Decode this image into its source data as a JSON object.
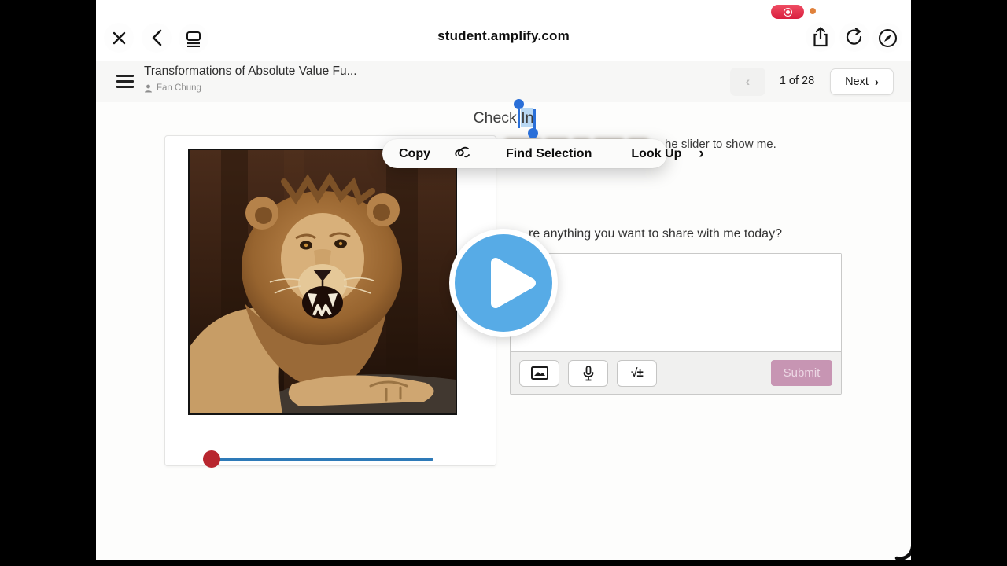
{
  "browser": {
    "address": "student.amplify.com",
    "recording_indicator": "screen-recording-active",
    "mic_indicator": "microphone-in-use"
  },
  "lesson_header": {
    "title": "Transformations of Absolute Value Fu...",
    "author": "Fan Chung",
    "page_indicator": "1 of 28",
    "prev_chevron": "‹",
    "next_label": "Next",
    "next_chevron": "›"
  },
  "main": {
    "heading_part1": "Check ",
    "heading_selected": "In",
    "instruction_visible_fragment": "he slider to show me.",
    "question_visible_fragment": "re anything you want to share with me today?",
    "answer_placeholder": "",
    "toolbar": {
      "image_button": "insert-image",
      "audio_button": "record-audio",
      "math_label": "√±",
      "submit_label": "Submit"
    }
  },
  "context_menu": {
    "items": [
      "Copy",
      "Find Selection",
      "Look Up"
    ],
    "more_chevron": "›"
  },
  "media": {
    "image_subject": "roaring lion",
    "play_button": "play-video"
  },
  "colors": {
    "selection_blue": "#2a6fd8",
    "selection_highlight": "#b9d8f3",
    "play_blue": "#57abe6",
    "slider_track_blue": "#2e7ab8",
    "slider_knob_red": "#b8262e",
    "submit_pink": "#c795b3",
    "record_red": "#d91f3f",
    "mic_orange": "#e0813b",
    "header_gray": "#f7f7f6"
  }
}
